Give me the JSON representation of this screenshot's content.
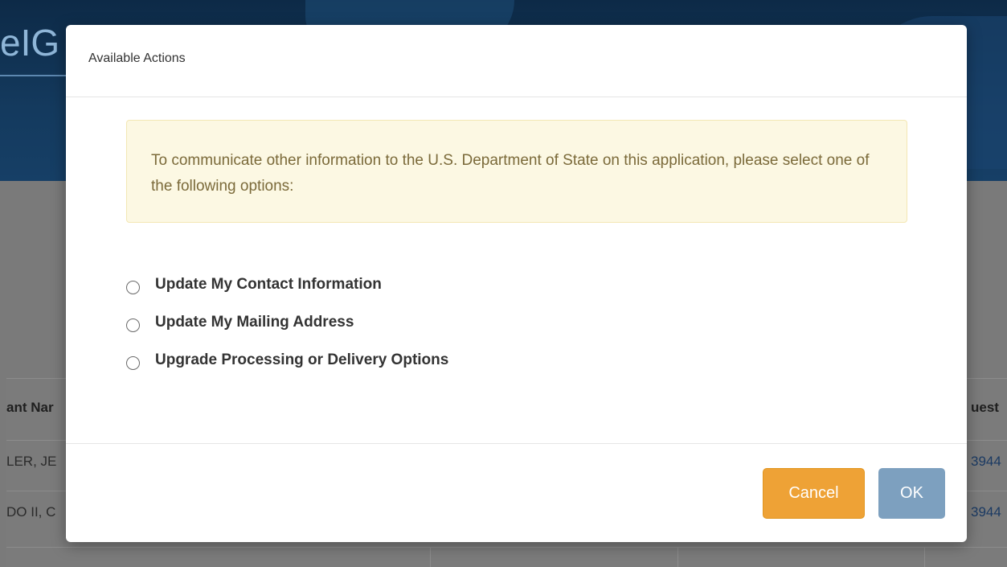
{
  "background": {
    "logo_text": "eIG",
    "table": {
      "headers": [
        "ant Nar",
        "uest"
      ],
      "rows": [
        {
          "name": "LER, JE",
          "request": "3944"
        },
        {
          "name": "DO II, C",
          "request": "3944"
        }
      ]
    }
  },
  "modal": {
    "title": "Available Actions",
    "alert_text": "To communicate other information to the U.S. Department of State on this application, please select one of the following options:",
    "options": [
      {
        "label": "Update My Contact Information",
        "selected": false
      },
      {
        "label": "Update My Mailing Address",
        "selected": false
      },
      {
        "label": "Upgrade Processing or Delivery Options",
        "selected": false
      }
    ],
    "buttons": {
      "cancel_label": "Cancel",
      "ok_label": "OK"
    }
  },
  "colors": {
    "alert_bg": "#fcf8e3",
    "cancel_button": "#eea236",
    "ok_button": "#7da0bf"
  }
}
